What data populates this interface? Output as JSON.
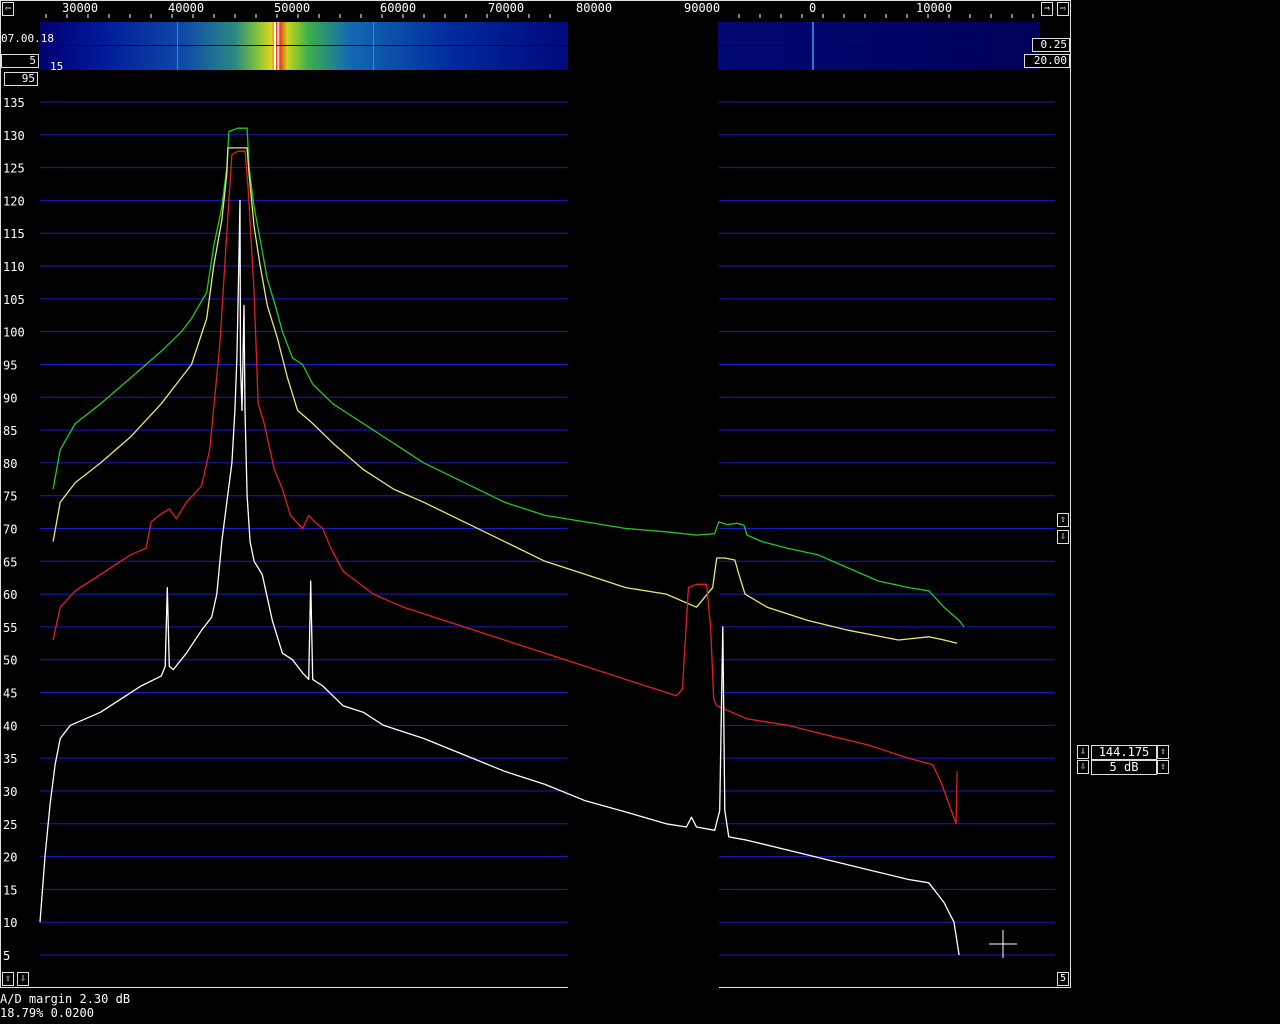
{
  "top_bar": {
    "freq_labels": [
      "30000",
      "40000",
      "50000",
      "60000",
      "70000",
      "80000",
      "90000",
      "0",
      "10000"
    ],
    "left_arrow_icon": "arrow-left",
    "right_arrow_icon": "arrow-right"
  },
  "waterfall": {
    "time_label": "07.00.18",
    "left_value_1": "5",
    "left_value_2": "15",
    "left_value_3": "95",
    "right_value_1": "0.25",
    "right_value_2": "20.00"
  },
  "side_controls": {
    "scroll_up_icon": "arrow-up",
    "scroll_down_icon": "arrow-down",
    "bottom_right_value": "5"
  },
  "readouts": {
    "frequency": "144.175",
    "db_step": "5 dB"
  },
  "status": {
    "ad_margin": "A/D margin  2.30 dB",
    "line2": "18.79% 0.0200"
  },
  "colors": {
    "grid": "#1a1ac8",
    "green": "#22c822",
    "yellow": "#e8e870",
    "red": "#e02020",
    "white": "#ffffff"
  },
  "chart_data": {
    "type": "line",
    "ylim": [
      0,
      140
    ],
    "yticks": [
      5,
      10,
      15,
      20,
      25,
      30,
      35,
      40,
      45,
      50,
      55,
      60,
      65,
      70,
      75,
      80,
      85,
      90,
      95,
      100,
      105,
      110,
      115,
      120,
      125,
      130,
      135
    ],
    "xlim": [
      0,
      1000
    ],
    "series": [
      {
        "color": "green",
        "points": [
          [
            13,
            76
          ],
          [
            20,
            82
          ],
          [
            35,
            86
          ],
          [
            60,
            89
          ],
          [
            90,
            93
          ],
          [
            120,
            97
          ],
          [
            140,
            100
          ],
          [
            150,
            102
          ],
          [
            165,
            106
          ],
          [
            172,
            113
          ],
          [
            180,
            119
          ],
          [
            185,
            125
          ],
          [
            187,
            130.5
          ],
          [
            196,
            131
          ],
          [
            205,
            131
          ],
          [
            207,
            125
          ],
          [
            212,
            119
          ],
          [
            218,
            114
          ],
          [
            225,
            108
          ],
          [
            233,
            104
          ],
          [
            240,
            100
          ],
          [
            250,
            96
          ],
          [
            260,
            95
          ],
          [
            270,
            92
          ],
          [
            290,
            89
          ],
          [
            310,
            87
          ],
          [
            330,
            85
          ],
          [
            350,
            83
          ],
          [
            380,
            80
          ],
          [
            420,
            77
          ],
          [
            460,
            74
          ],
          [
            500,
            72
          ],
          [
            540,
            71
          ],
          [
            580,
            70
          ],
          [
            620,
            69.5
          ],
          [
            650,
            69
          ],
          [
            668,
            69.2
          ],
          [
            672,
            71
          ],
          [
            680,
            70.6
          ],
          [
            690,
            70.8
          ],
          [
            697,
            70.5
          ],
          [
            700,
            69
          ],
          [
            715,
            68
          ],
          [
            740,
            67
          ],
          [
            770,
            66
          ],
          [
            800,
            64
          ],
          [
            830,
            62
          ],
          [
            860,
            61
          ],
          [
            880,
            60.5
          ],
          [
            895,
            58
          ],
          [
            910,
            56
          ],
          [
            915,
            55
          ]
        ]
      },
      {
        "color": "yellow",
        "points": [
          [
            13,
            68
          ],
          [
            20,
            74
          ],
          [
            35,
            77
          ],
          [
            60,
            80
          ],
          [
            90,
            84
          ],
          [
            120,
            89
          ],
          [
            140,
            93
          ],
          [
            150,
            95
          ],
          [
            165,
            102
          ],
          [
            172,
            110
          ],
          [
            180,
            117
          ],
          [
            185,
            124
          ],
          [
            186,
            128
          ],
          [
            195,
            128
          ],
          [
            205,
            128
          ],
          [
            207,
            124
          ],
          [
            212,
            116
          ],
          [
            218,
            110
          ],
          [
            225,
            104
          ],
          [
            235,
            99
          ],
          [
            245,
            93
          ],
          [
            255,
            88
          ],
          [
            270,
            86
          ],
          [
            290,
            83
          ],
          [
            320,
            79
          ],
          [
            350,
            76
          ],
          [
            380,
            74
          ],
          [
            420,
            71
          ],
          [
            460,
            68
          ],
          [
            500,
            65
          ],
          [
            540,
            63
          ],
          [
            580,
            61
          ],
          [
            620,
            60
          ],
          [
            650,
            58
          ],
          [
            666,
            61
          ],
          [
            670,
            65.5
          ],
          [
            678,
            65.5
          ],
          [
            688,
            65.2
          ],
          [
            692,
            63
          ],
          [
            698,
            60
          ],
          [
            720,
            58
          ],
          [
            760,
            56
          ],
          [
            800,
            54.5
          ],
          [
            850,
            53
          ],
          [
            880,
            53.5
          ],
          [
            895,
            53
          ],
          [
            908,
            52.5
          ]
        ]
      },
      {
        "color": "red",
        "points": [
          [
            13,
            53
          ],
          [
            20,
            58
          ],
          [
            35,
            60.5
          ],
          [
            60,
            63
          ],
          [
            90,
            66
          ],
          [
            105,
            67
          ],
          [
            110,
            71
          ],
          [
            118,
            72
          ],
          [
            128,
            73
          ],
          [
            135,
            71.5
          ],
          [
            145,
            74
          ],
          [
            160,
            76.5
          ],
          [
            168,
            82
          ],
          [
            178,
            98
          ],
          [
            185,
            115
          ],
          [
            190,
            127
          ],
          [
            196,
            127.5
          ],
          [
            203,
            127.5
          ],
          [
            206,
            122
          ],
          [
            212,
            106
          ],
          [
            216,
            89
          ],
          [
            222,
            86
          ],
          [
            232,
            79
          ],
          [
            240,
            76
          ],
          [
            248,
            72
          ],
          [
            260,
            70
          ],
          [
            266,
            72
          ],
          [
            272,
            71
          ],
          [
            280,
            70
          ],
          [
            288,
            67
          ],
          [
            300,
            63.5
          ],
          [
            330,
            60
          ],
          [
            360,
            58
          ],
          [
            400,
            56
          ],
          [
            440,
            54
          ],
          [
            480,
            52
          ],
          [
            520,
            50
          ],
          [
            560,
            48
          ],
          [
            600,
            46
          ],
          [
            630,
            44.5
          ],
          [
            636,
            45.5
          ],
          [
            642,
            61
          ],
          [
            650,
            61.5
          ],
          [
            660,
            61.5
          ],
          [
            664,
            55
          ],
          [
            667,
            44
          ],
          [
            670,
            43
          ],
          [
            700,
            41
          ],
          [
            740,
            40
          ],
          [
            780,
            38.5
          ],
          [
            820,
            37
          ],
          [
            860,
            35
          ],
          [
            884,
            34
          ],
          [
            893,
            31
          ],
          [
            900,
            28
          ],
          [
            907,
            25
          ],
          [
            908,
            33
          ]
        ]
      },
      {
        "color": "white",
        "points": [
          [
            0,
            10
          ],
          [
            5,
            20
          ],
          [
            10,
            28
          ],
          [
            15,
            34
          ],
          [
            20,
            38
          ],
          [
            30,
            40
          ],
          [
            45,
            41
          ],
          [
            60,
            42
          ],
          [
            80,
            44
          ],
          [
            100,
            46
          ],
          [
            120,
            47.5
          ],
          [
            124,
            49
          ],
          [
            126,
            61
          ],
          [
            128,
            49
          ],
          [
            132,
            48.5
          ],
          [
            145,
            51
          ],
          [
            160,
            54.5
          ],
          [
            170,
            56.5
          ],
          [
            175,
            60
          ],
          [
            180,
            68
          ],
          [
            185,
            74
          ],
          [
            190,
            80
          ],
          [
            193,
            88
          ],
          [
            195,
            96
          ],
          [
            196,
            104
          ],
          [
            197,
            112
          ],
          [
            198,
            120
          ],
          [
            198.5,
            95
          ],
          [
            200,
            88
          ],
          [
            202,
            104
          ],
          [
            203,
            88
          ],
          [
            205,
            75
          ],
          [
            208,
            68
          ],
          [
            212,
            65
          ],
          [
            220,
            63
          ],
          [
            230,
            56
          ],
          [
            240,
            51
          ],
          [
            250,
            50
          ],
          [
            260,
            48
          ],
          [
            266,
            47
          ],
          [
            268,
            62
          ],
          [
            270,
            47
          ],
          [
            280,
            46
          ],
          [
            300,
            43
          ],
          [
            320,
            42
          ],
          [
            340,
            40
          ],
          [
            380,
            38
          ],
          [
            420,
            35.5
          ],
          [
            460,
            33
          ],
          [
            500,
            31
          ],
          [
            540,
            28.5
          ],
          [
            580,
            26.8
          ],
          [
            620,
            25
          ],
          [
            640,
            24.5
          ],
          [
            645,
            26
          ],
          [
            650,
            24.5
          ],
          [
            668,
            24
          ],
          [
            673,
            27
          ],
          [
            676,
            55
          ],
          [
            678,
            27
          ],
          [
            682,
            23
          ],
          [
            700,
            22.5
          ],
          [
            740,
            21
          ],
          [
            780,
            19.5
          ],
          [
            820,
            18
          ],
          [
            860,
            16.5
          ],
          [
            880,
            16
          ],
          [
            895,
            13
          ],
          [
            905,
            10
          ],
          [
            910,
            5
          ]
        ]
      }
    ]
  }
}
